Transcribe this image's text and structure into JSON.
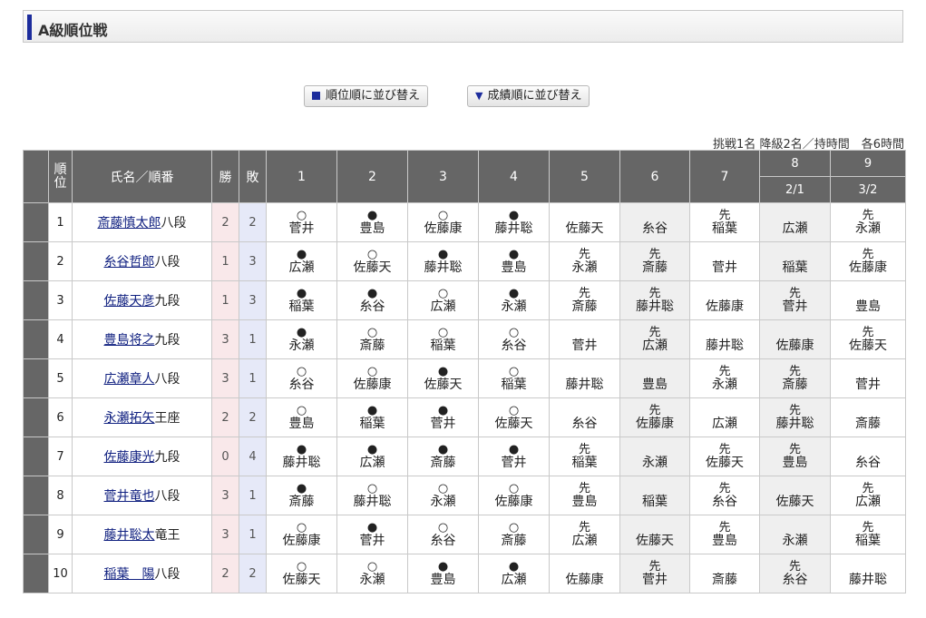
{
  "title": "A級順位戦",
  "sort_buttons": {
    "rank": "順位順に並び替え",
    "score": "成績順に並び替え"
  },
  "info": "挑戦1名 降級2名／持時間　各6時間",
  "headers": {
    "rank": "順位",
    "name": "氏名／順番",
    "win": "勝",
    "lose": "敗",
    "rounds": [
      "1",
      "2",
      "3",
      "4",
      "5",
      "6",
      "7",
      "8",
      "9"
    ],
    "dates": {
      "8": "2/1",
      "9": "3/2"
    }
  },
  "players": [
    {
      "rank": "1",
      "name": "斎藤慎太郎",
      "title": "八段",
      "w": "2",
      "l": "2",
      "results": [
        {
          "m": "○",
          "o": "菅井"
        },
        {
          "m": "●",
          "o": "豊島"
        },
        {
          "m": "○",
          "o": "佐藤康"
        },
        {
          "m": "●",
          "o": "藤井聡"
        },
        {
          "m": "",
          "o": "佐藤天"
        },
        {
          "m": "",
          "o": "糸谷"
        },
        {
          "m": "先",
          "o": "稲葉"
        },
        {
          "m": "",
          "o": "広瀬"
        },
        {
          "m": "先",
          "o": "永瀬"
        }
      ]
    },
    {
      "rank": "2",
      "name": "糸谷哲郎",
      "title": "八段",
      "w": "1",
      "l": "3",
      "results": [
        {
          "m": "●",
          "o": "広瀬"
        },
        {
          "m": "○",
          "o": "佐藤天"
        },
        {
          "m": "●",
          "o": "藤井聡"
        },
        {
          "m": "●",
          "o": "豊島"
        },
        {
          "m": "先",
          "o": "永瀬"
        },
        {
          "m": "先",
          "o": "斎藤"
        },
        {
          "m": "",
          "o": "菅井"
        },
        {
          "m": "",
          "o": "稲葉"
        },
        {
          "m": "先",
          "o": "佐藤康"
        }
      ]
    },
    {
      "rank": "3",
      "name": "佐藤天彦",
      "title": "九段",
      "w": "1",
      "l": "3",
      "results": [
        {
          "m": "●",
          "o": "稲葉"
        },
        {
          "m": "●",
          "o": "糸谷"
        },
        {
          "m": "○",
          "o": "広瀬"
        },
        {
          "m": "●",
          "o": "永瀬"
        },
        {
          "m": "先",
          "o": "斎藤"
        },
        {
          "m": "先",
          "o": "藤井聡"
        },
        {
          "m": "",
          "o": "佐藤康"
        },
        {
          "m": "先",
          "o": "菅井"
        },
        {
          "m": "",
          "o": "豊島"
        }
      ]
    },
    {
      "rank": "4",
      "name": "豊島将之",
      "title": "九段",
      "w": "3",
      "l": "1",
      "results": [
        {
          "m": "●",
          "o": "永瀬"
        },
        {
          "m": "○",
          "o": "斎藤"
        },
        {
          "m": "○",
          "o": "稲葉"
        },
        {
          "m": "○",
          "o": "糸谷"
        },
        {
          "m": "",
          "o": "菅井"
        },
        {
          "m": "先",
          "o": "広瀬"
        },
        {
          "m": "",
          "o": "藤井聡"
        },
        {
          "m": "",
          "o": "佐藤康"
        },
        {
          "m": "先",
          "o": "佐藤天"
        }
      ]
    },
    {
      "rank": "5",
      "name": "広瀬章人",
      "title": "八段",
      "w": "3",
      "l": "1",
      "results": [
        {
          "m": "○",
          "o": "糸谷"
        },
        {
          "m": "○",
          "o": "佐藤康"
        },
        {
          "m": "●",
          "o": "佐藤天"
        },
        {
          "m": "○",
          "o": "稲葉"
        },
        {
          "m": "",
          "o": "藤井聡"
        },
        {
          "m": "",
          "o": "豊島"
        },
        {
          "m": "先",
          "o": "永瀬"
        },
        {
          "m": "先",
          "o": "斎藤"
        },
        {
          "m": "",
          "o": "菅井"
        }
      ]
    },
    {
      "rank": "6",
      "name": "永瀬拓矢",
      "title": "王座",
      "w": "2",
      "l": "2",
      "results": [
        {
          "m": "○",
          "o": "豊島"
        },
        {
          "m": "●",
          "o": "稲葉"
        },
        {
          "m": "●",
          "o": "菅井"
        },
        {
          "m": "○",
          "o": "佐藤天"
        },
        {
          "m": "",
          "o": "糸谷"
        },
        {
          "m": "先",
          "o": "佐藤康"
        },
        {
          "m": "",
          "o": "広瀬"
        },
        {
          "m": "先",
          "o": "藤井聡"
        },
        {
          "m": "",
          "o": "斎藤"
        }
      ]
    },
    {
      "rank": "7",
      "name": "佐藤康光",
      "title": "九段",
      "w": "0",
      "l": "4",
      "results": [
        {
          "m": "●",
          "o": "藤井聡"
        },
        {
          "m": "●",
          "o": "広瀬"
        },
        {
          "m": "●",
          "o": "斎藤"
        },
        {
          "m": "●",
          "o": "菅井"
        },
        {
          "m": "先",
          "o": "稲葉"
        },
        {
          "m": "",
          "o": "永瀬"
        },
        {
          "m": "先",
          "o": "佐藤天"
        },
        {
          "m": "先",
          "o": "豊島"
        },
        {
          "m": "",
          "o": "糸谷"
        }
      ]
    },
    {
      "rank": "8",
      "name": "菅井竜也",
      "title": "八段",
      "w": "3",
      "l": "1",
      "results": [
        {
          "m": "●",
          "o": "斎藤"
        },
        {
          "m": "○",
          "o": "藤井聡"
        },
        {
          "m": "○",
          "o": "永瀬"
        },
        {
          "m": "○",
          "o": "佐藤康"
        },
        {
          "m": "先",
          "o": "豊島"
        },
        {
          "m": "",
          "o": "稲葉"
        },
        {
          "m": "先",
          "o": "糸谷"
        },
        {
          "m": "",
          "o": "佐藤天"
        },
        {
          "m": "先",
          "o": "広瀬"
        }
      ]
    },
    {
      "rank": "9",
      "name": "藤井聡太",
      "title": "竜王",
      "w": "3",
      "l": "1",
      "results": [
        {
          "m": "○",
          "o": "佐藤康"
        },
        {
          "m": "●",
          "o": "菅井"
        },
        {
          "m": "○",
          "o": "糸谷"
        },
        {
          "m": "○",
          "o": "斎藤"
        },
        {
          "m": "先",
          "o": "広瀬"
        },
        {
          "m": "",
          "o": "佐藤天"
        },
        {
          "m": "先",
          "o": "豊島"
        },
        {
          "m": "",
          "o": "永瀬"
        },
        {
          "m": "先",
          "o": "稲葉"
        }
      ]
    },
    {
      "rank": "10",
      "name": "稲葉　陽",
      "title": "八段",
      "w": "2",
      "l": "2",
      "results": [
        {
          "m": "○",
          "o": "佐藤天"
        },
        {
          "m": "○",
          "o": "永瀬"
        },
        {
          "m": "●",
          "o": "豊島"
        },
        {
          "m": "●",
          "o": "広瀬"
        },
        {
          "m": "",
          "o": "佐藤康"
        },
        {
          "m": "先",
          "o": "菅井"
        },
        {
          "m": "",
          "o": "斎藤"
        },
        {
          "m": "先",
          "o": "糸谷"
        },
        {
          "m": "",
          "o": "藤井聡"
        }
      ]
    }
  ],
  "colors": {
    "accent": "#1c2c9c",
    "header_bg": "#666666",
    "win_bg": "#f9e8ea",
    "lose_bg": "#e6e9f8",
    "link": "#102080"
  }
}
